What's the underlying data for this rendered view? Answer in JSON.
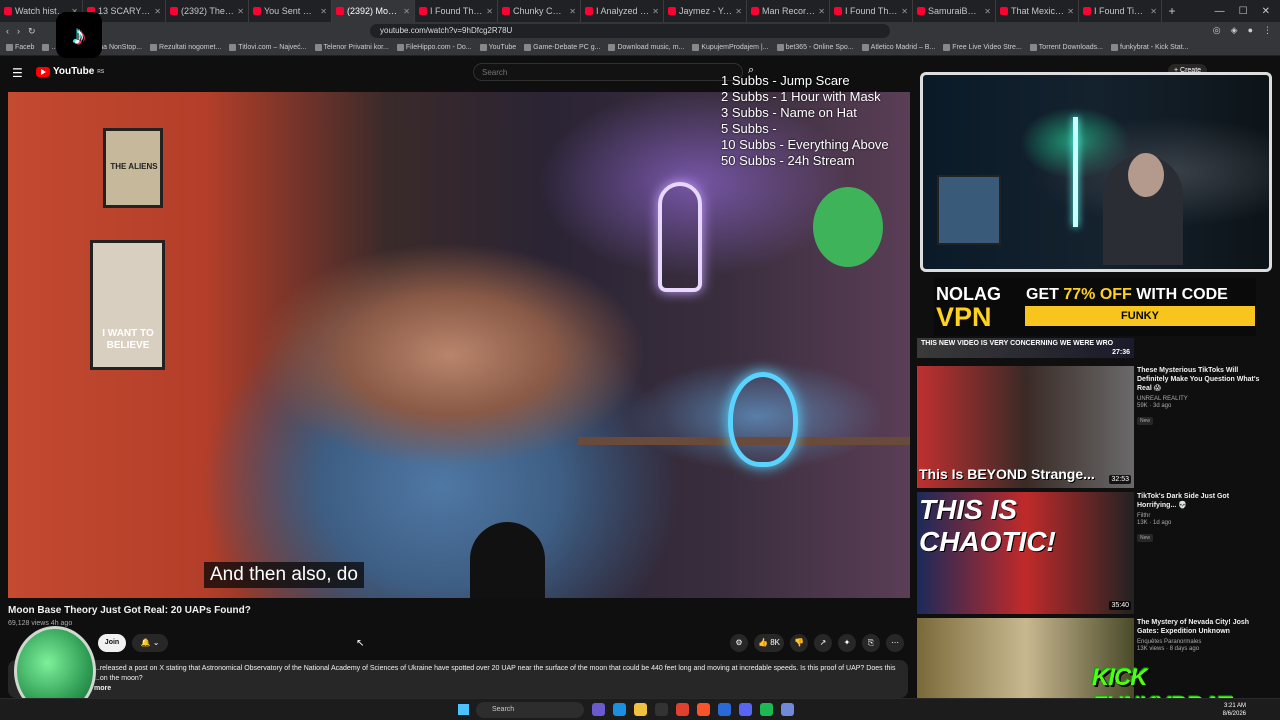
{
  "browser": {
    "tabs": [
      {
        "label": "Watch history - YouTube"
      },
      {
        "label": "13 SCARY GHOST MO"
      },
      {
        "label": "(2392) These Mystero"
      },
      {
        "label": "You Sent Me Your UF"
      },
      {
        "label": "(2392) Moon B",
        "active": true
      },
      {
        "label": "I Found The TikTok Cl"
      },
      {
        "label": "Chunky Cholo Auditi"
      },
      {
        "label": "I Analyzed 31 Officia"
      },
      {
        "label": "Jaymez - YouTube"
      },
      {
        "label": "Man Records \"Alien S"
      },
      {
        "label": "I Found The Most Dis"
      },
      {
        "label": "SamuraiBarbi - YouTu"
      },
      {
        "label": "That Mexican OT - Jus"
      },
      {
        "label": "I Found TikTok's Dark"
      }
    ],
    "new_tab": "+",
    "url": "youtube.com/watch?v=9hDfcg2R78U",
    "bookmarks": [
      "Faceb",
      "...",
      "Pokloni na NonStop...",
      "Rezultati nogomet...",
      "Titlovi.com – Najveć...",
      "Telenor Privatni kor...",
      "FileHippo.com - Do...",
      "YouTube",
      "Game-Debate PC g...",
      "Download music, m...",
      "KupujemProdajem |...",
      "bet365 - Online Spo...",
      "Atletico Madrid – B...",
      "Free Live Video Stre...",
      "Torrent Downloads...",
      "funkybrat - Kick Stat..."
    ]
  },
  "youtube": {
    "logo": "YouTube",
    "logo_suffix": "RS",
    "search_placeholder": "Search",
    "create_label": "+ Create"
  },
  "video": {
    "subtitle": "And then also, do",
    "title": "Moon Base Theory Just Got Real: 20 UAPs Found?",
    "views": "69,128 views  4h ago",
    "join_label": "Join",
    "bell_label": "🔔 ⌄",
    "like_count": "8K",
    "description": "...released a post on X stating that  Astronomical Observatory of the National Academy of Sciences of Ukraine have spotted over 20 UAP near the surface of the moon that could be 440 feet long and moving at incredable speeds. Is this proof of UAP? Does this ...on the moon?",
    "more_label": "more",
    "poster_text": "I WANT TO BELIEVE",
    "poster2_text": "THE ALIENS"
  },
  "overlay": {
    "lines": [
      "1 Subbs - Jump Scare",
      "2 Subbs - 1 Hour with Mask",
      "3 Subbs - Name on Hat",
      "5 Subbs -",
      "10 Subbs - Everything Above",
      "50 Subbs - 24h Stream"
    ]
  },
  "vpn_ad": {
    "logo_top": "NOLAG",
    "logo_bottom": "VPN",
    "offer_prefix": "GET ",
    "offer_pct": "77% OFF",
    "offer_suffix": " WITH CODE",
    "code": "FUNKY"
  },
  "recommendations": [
    {
      "thumb_caption": "This Is BEYOND Strange...",
      "duration": "32:53",
      "title": "These Mysterious TikToks Will Definitely Make You Question What's Real 😱",
      "channel": "UNREAL REALITY",
      "views": "59K · 3d ago",
      "badge": "New",
      "colors": [
        "#c03030",
        "#3a2a26",
        "#6a6a6a"
      ]
    },
    {
      "thumb_caption": "THIS IS CHAOTIC!",
      "duration": "35:40",
      "title": "TikTok's Dark Side Just Got Horrifying... 💀",
      "channel": "Filthr",
      "views": "13K · 1d ago",
      "badge": "New",
      "colors": [
        "#1b2a5a",
        "#c02a2a",
        "#222"
      ]
    },
    {
      "thumb_caption": "",
      "duration": "",
      "title": "The Mystery of Nevada City! Josh Gates: Expedition Unknown",
      "channel": "Enquêtes Paranormales",
      "views": "13K views · 8 days ago",
      "badge": "",
      "colors": [
        "#7a6a3a",
        "#c8b890",
        "#4a4a2a"
      ]
    }
  ],
  "rec_top_caption": "THIS NEW VIDEO IS VERY CONCERNING   WE WERE WRO",
  "rec_top_duration": "27:36",
  "kick_logo": "KICK FUNKYBRAT",
  "tiktok_glyph": "♪",
  "taskbar": {
    "search": "Search",
    "time": "3:21 AM",
    "date": "8/6/2026"
  }
}
